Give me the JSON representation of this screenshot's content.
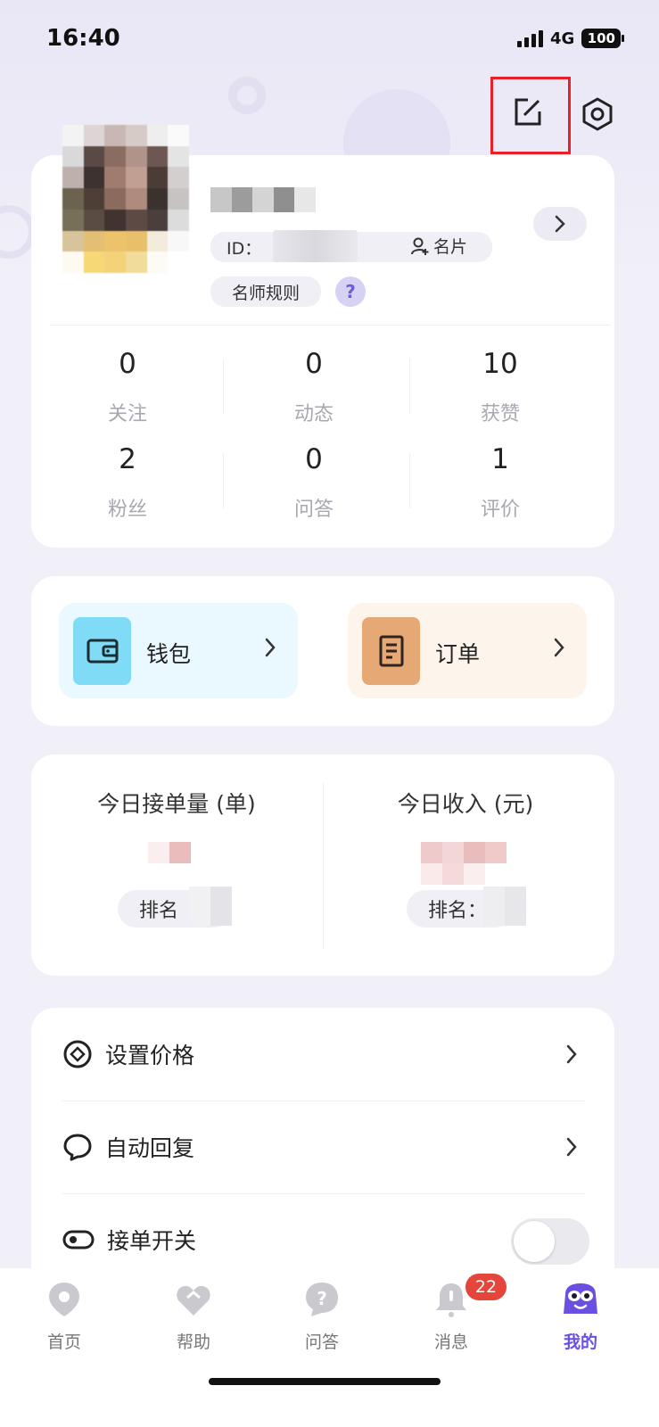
{
  "status_bar": {
    "time": "16:40",
    "network": "4G",
    "battery": "100"
  },
  "header": {
    "edit_icon": "edit-square-icon",
    "settings_icon": "gear-icon"
  },
  "profile": {
    "id_label": "ID：",
    "card_button": "名片",
    "rules_label": "名师规则",
    "help_symbol": "?",
    "stats": [
      {
        "value": "0",
        "label": "关注"
      },
      {
        "value": "0",
        "label": "动态"
      },
      {
        "value": "10",
        "label": "获赞"
      },
      {
        "value": "2",
        "label": "粉丝"
      },
      {
        "value": "0",
        "label": "问答"
      },
      {
        "value": "1",
        "label": "评价"
      }
    ]
  },
  "quick_links": {
    "wallet": {
      "label": "钱包",
      "icon": "wallet-icon",
      "color": "#7fdbf6"
    },
    "orders": {
      "label": "订单",
      "icon": "document-icon",
      "color": "#e6a875"
    }
  },
  "today": {
    "orders_title": "今日接单量 (单)",
    "income_title": "今日收入 (元)",
    "orders_rank_label": "排名",
    "income_rank_label": "排名："
  },
  "menu": [
    {
      "label": "设置价格",
      "icon": "price-coin-icon"
    },
    {
      "label": "自动回复",
      "icon": "chat-bubble-icon"
    },
    {
      "label": "接单开关",
      "icon": "toggle-icon",
      "toggle_on": false
    }
  ],
  "tabs": [
    {
      "label": "首页",
      "icon": "home-icon"
    },
    {
      "label": "帮助",
      "icon": "help-heart-icon"
    },
    {
      "label": "问答",
      "icon": "question-icon"
    },
    {
      "label": "消息",
      "icon": "bell-icon",
      "badge": "22"
    },
    {
      "label": "我的",
      "icon": "mascot-icon",
      "active": true
    }
  ],
  "colors": {
    "accent": "#6b4fe0",
    "badge": "#e5453a",
    "highlight_box": "#e8202a"
  }
}
